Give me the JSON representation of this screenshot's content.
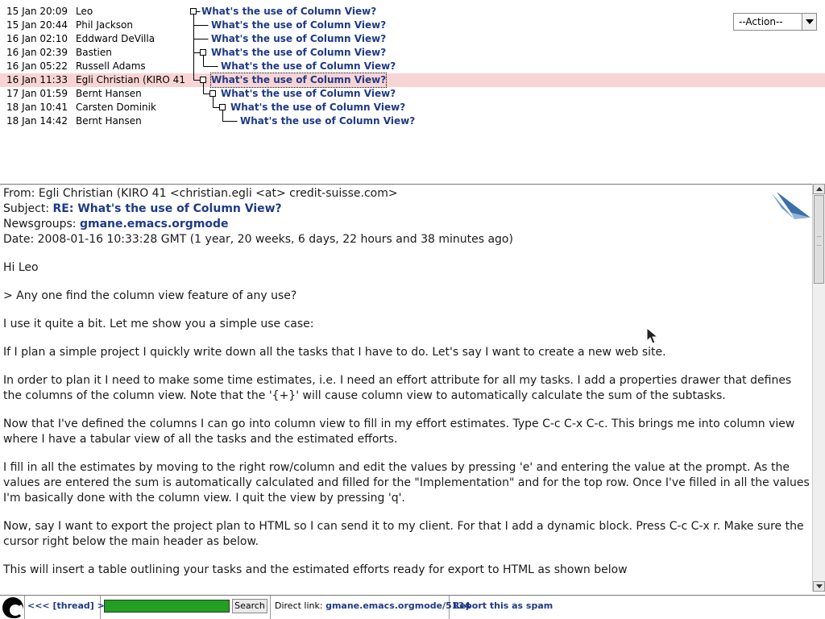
{
  "thread": {
    "rows": [
      {
        "date": "15 Jan 20:09",
        "author": "Leo",
        "subject": "What's the use of Column View?"
      },
      {
        "date": "15 Jan 20:44",
        "author": "Phil Jackson",
        "subject": "What's the use of Column View?"
      },
      {
        "date": "16 Jan 02:10",
        "author": "Eddward DeVilla",
        "subject": "What's the use of Column View?"
      },
      {
        "date": "16 Jan 02:39",
        "author": "Bastien",
        "subject": "What's the use of Column View?"
      },
      {
        "date": "16 Jan 05:22",
        "author": "Russell Adams",
        "subject": "What's the use of Column View?"
      },
      {
        "date": "16 Jan 11:33",
        "author": "Egli Christian (KIRO 41",
        "subject": "What's the use of Column View?"
      },
      {
        "date": "17 Jan 01:59",
        "author": "Bernt Hansen",
        "subject": "What's the use of Column View?"
      },
      {
        "date": "18 Jan 10:41",
        "author": "Carsten Dominik",
        "subject": "What's the use of Column View?"
      },
      {
        "date": "18 Jan 14:42",
        "author": "Bernt Hansen",
        "subject": "What's the use of Column View?"
      }
    ],
    "action_select": "--Action--"
  },
  "article": {
    "from_label": "From:",
    "from_value": "Egli Christian (KIRO 41 <christian.egli <at> credit-suisse.com>",
    "subject_label": "Subject:",
    "subject_value": "RE: What's the use of Column View?",
    "newsgroups_label": "Newsgroups:",
    "newsgroups_value": "gmane.emacs.orgmode",
    "date_label": "Date:",
    "date_value": "2008-01-16 10:33:28 GMT (1 year, 20 weeks, 6 days, 22 hours and 38 minutes ago)",
    "paragraphs": [
      "Hi Leo",
      "> Any one find the column view feature of any use?",
      "I use it quite a bit. Let me show you a simple use case:",
      "If I plan a simple project I quickly write down all the tasks that I have to do. Let's say I want to create a new web site.",
      "In order to plan it I need to make some time estimates, i.e. I need an effort attribute for all my tasks. I add a properties drawer that defines the columns of the column view. Note that the '{+}' will cause column view to automatically calculate the sum of the subtasks.",
      "Now that I've defined the columns I can go into column view to fill in my effort estimates. Type C-c C-x C-c. This brings me into column view where I have a tabular view of all the tasks and the estimated efforts.",
      "I fill in all the estimates by moving to the right row/column and edit the values by pressing 'e' and entering the value at the prompt. As the values are entered the sum is automatically calculated and filled for the \"Implementation\" and for the top row. Once I've filled in all the values I'm basically done with the column view. I quit the view by pressing 'q'.",
      "Now, say I want to export the project plan to HTML so I can send it to my client. For that I add a dynamic block. Press C-c C-x r. Make sure the cursor right below the main header as below.",
      "This will insert a table outlining your tasks and the estimated efforts ready for export to HTML as shown below"
    ]
  },
  "footer": {
    "thread_nav": "<<< [thread] >>>",
    "search_button": "Search",
    "direct_label": "Direct link:",
    "direct_link": "gmane.emacs.orgmode/5134",
    "spam_link": "Report this as spam"
  },
  "colors": {
    "link": "#1f3a86",
    "highlight_row": "#f9d4d4",
    "search_field": "#22a022"
  }
}
